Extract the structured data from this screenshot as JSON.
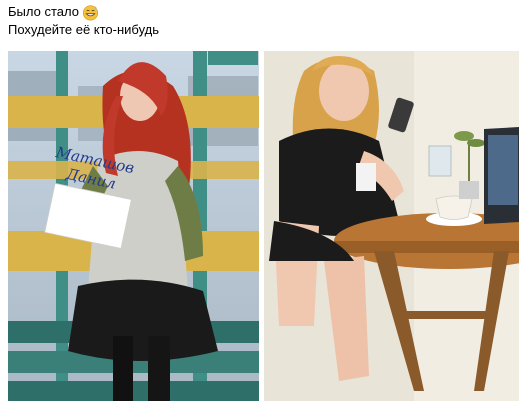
{
  "post": {
    "line1_text": "Было стало",
    "line1_emoji": "grinning-sweat-emoji",
    "line2_text": "Похудейте её кто-нибудь"
  },
  "photos": [
    {
      "name": "before-photo",
      "sign": {
        "line1": "Маташов",
        "line2": "Данил"
      }
    },
    {
      "name": "after-photo"
    }
  ],
  "colors": {
    "background": "#ffffff",
    "text": "#000000",
    "bench_yellow": "#d9b44a",
    "bench_teal": "#3f8f86",
    "hair_red": "#c0392b",
    "shirt_olive": "#6e7d45"
  }
}
